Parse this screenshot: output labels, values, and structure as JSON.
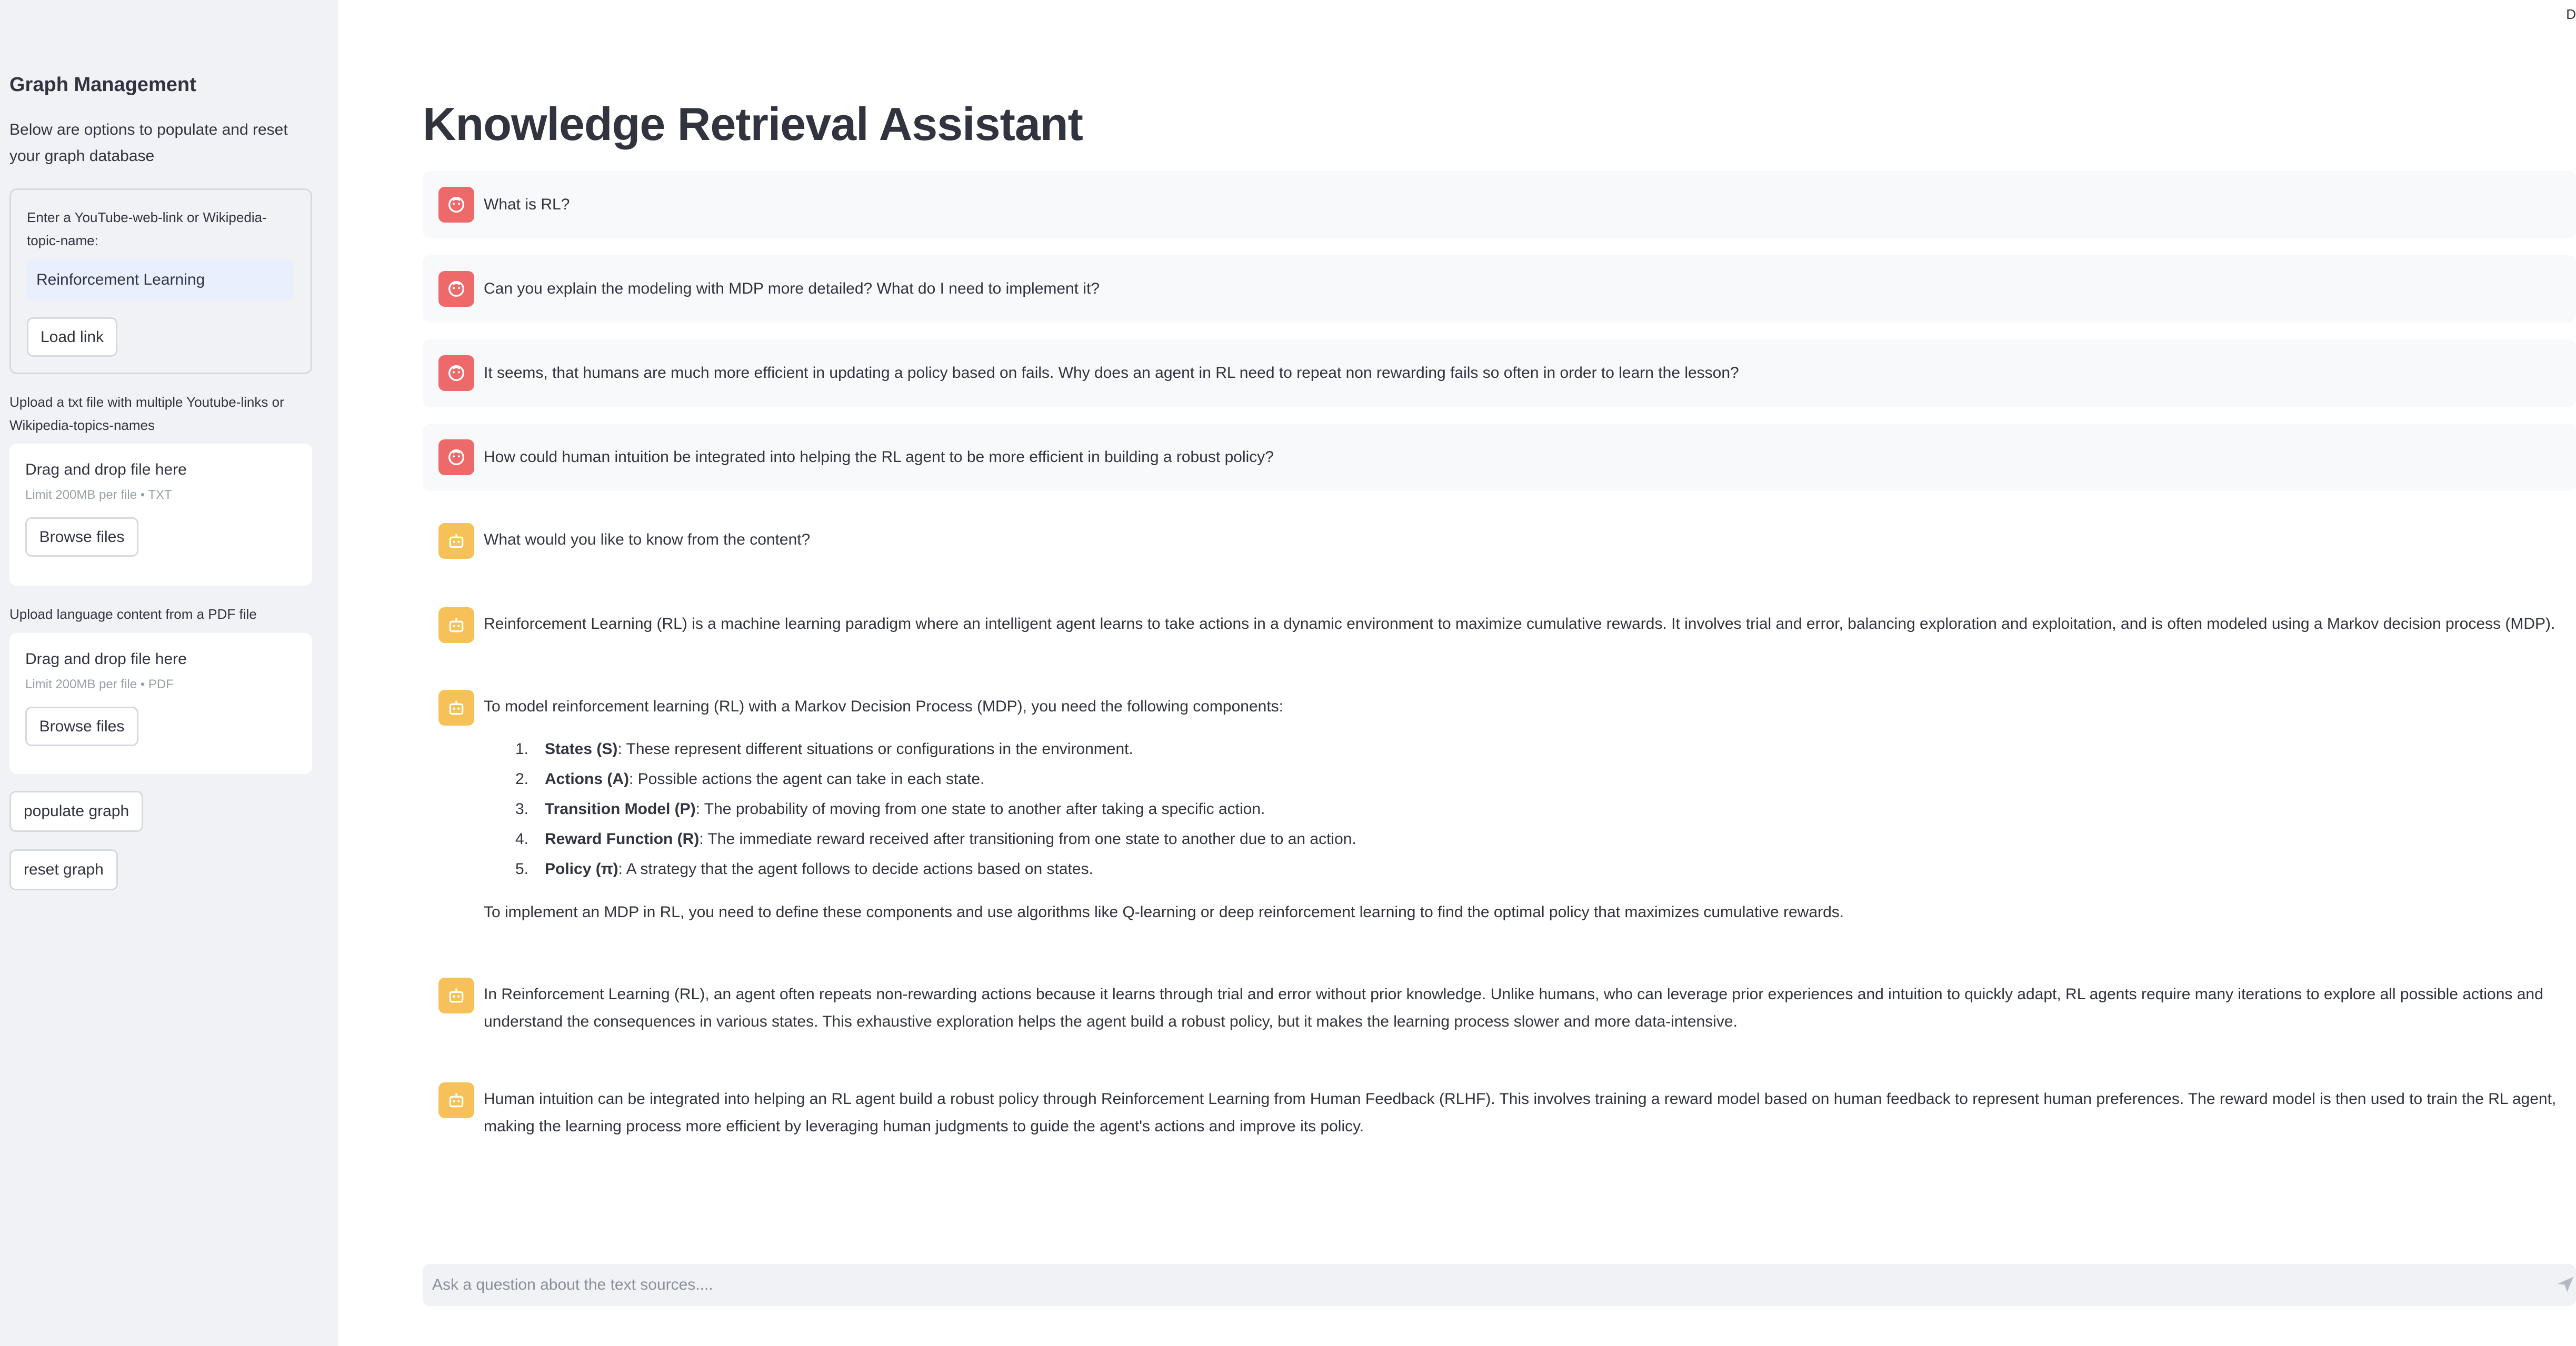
{
  "sidebar": {
    "title": "Graph Management",
    "description": "Below are options to populate and reset your graph database",
    "link_form": {
      "label": "Enter a YouTube-web-link or Wikipedia-topic-name:",
      "value": "Reinforcement Learning",
      "button": "Load link"
    },
    "txt_upload": {
      "label": "Upload a txt file with multiple Youtube-links or Wikipedia-topics-names",
      "drop_text": "Drag and drop file here",
      "limit": "Limit 200MB per file • TXT",
      "button": "Browse files"
    },
    "pdf_upload": {
      "label": "Upload language content from a PDF file",
      "drop_text": "Drag and drop file here",
      "limit": "Limit 200MB per file • PDF",
      "button": "Browse files"
    },
    "populate_button": "populate graph",
    "reset_button": "reset graph"
  },
  "main": {
    "corner": "D",
    "title": "Knowledge Retrieval Assistant",
    "user_messages": [
      "What is RL?",
      "Can you explain the modeling with MDP more detailed? What do I need to implement it?",
      "It seems, that humans are much more efficient in updating a policy based on fails. Why does an agent in RL need to repeat non rewarding fails so often in order to learn the lesson?",
      "How could human intuition be integrated into helping the RL agent to be more efficient in building a robust policy?"
    ],
    "bot_messages": {
      "greeting": "What would you like to know from the content?",
      "rl_definition": "Reinforcement Learning (RL) is a machine learning paradigm where an intelligent agent learns to take actions in a dynamic environment to maximize cumulative rewards. It involves trial and error, balancing exploration and exploitation, and is often modeled using a Markov decision process (MDP).",
      "mdp_intro": "To model reinforcement learning (RL) with a Markov Decision Process (MDP), you need the following components:",
      "mdp_items": [
        {
          "num": "1.",
          "term": "States (S)",
          "desc": ": These represent different situations or configurations in the environment."
        },
        {
          "num": "2.",
          "term": "Actions (A)",
          "desc": ": Possible actions the agent can take in each state."
        },
        {
          "num": "3.",
          "term": "Transition Model (P)",
          "desc": ": The probability of moving from one state to another after taking a specific action."
        },
        {
          "num": "4.",
          "term": "Reward Function (R)",
          "desc": ": The immediate reward received after transitioning from one state to another due to an action."
        },
        {
          "num": "5.",
          "term": "Policy (π)",
          "desc": ": A strategy that the agent follows to decide actions based on states."
        }
      ],
      "mdp_outro": "To implement an MDP in RL, you need to define these components and use algorithms like Q-learning or deep reinforcement learning to find the optimal policy that maximizes cumulative rewards.",
      "repeat_answer": "In Reinforcement Learning (RL), an agent often repeats non-rewarding actions because it learns through trial and error without prior knowledge. Unlike humans, who can leverage prior experiences and intuition to quickly adapt, RL agents require many iterations to explore all possible actions and understand the consequences in various states. This exhaustive exploration helps the agent build a robust policy, but it makes the learning process slower and more data-intensive.",
      "rlhf_answer": "Human intuition can be integrated into helping an RL agent build a robust policy through Reinforcement Learning from Human Feedback (RLHF). This involves training a reward model based on human feedback to represent human preferences. The reward model is then used to train the RL agent, making the learning process more efficient by leveraging human judgments to guide the agent's actions and improve its policy."
    },
    "chat_placeholder": "Ask a question about the text sources....",
    "icons": {
      "user_avatar": "user-avatar-icon",
      "bot_avatar": "robot-icon",
      "send": "send-icon"
    },
    "colors": {
      "user_avatar": "#ee6a6a",
      "bot_avatar": "#f7c15a",
      "sidebar_bg": "#f0f2f6"
    }
  }
}
